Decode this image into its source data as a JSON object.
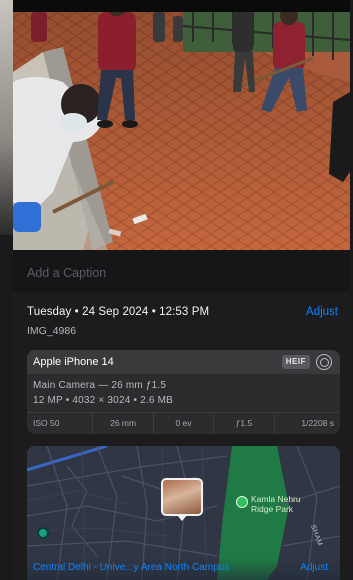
{
  "caption": {
    "placeholder": "Add a Caption"
  },
  "info": {
    "date_time": "Tuesday • 24 Sep 2024 • 12:53 PM",
    "adjust_label": "Adjust",
    "filename": "IMG_4986"
  },
  "device": {
    "name": "Apple iPhone 14",
    "format_badge": "HEIF",
    "camera": "Main Camera — 26 mm ƒ1.5",
    "specs": "12 MP • 4032 × 3024 • 2.6 MB",
    "exif": [
      "ISO 50",
      "26 mm",
      "0 ev",
      "ƒ1.5",
      "1/2208 s"
    ]
  },
  "map": {
    "park_label_line1": "Kamla Nehru",
    "park_label_line2": "Ridge Park",
    "road_label": "SHAM",
    "location_name": "Central Delhi - Unive...y Area North Campus",
    "adjust_label": "Adjust"
  },
  "colors": {
    "accent": "#0a84ff",
    "panel": "#1c1c1e",
    "card": "#2c2c2e",
    "park": "#1f7a45"
  },
  "icons": [
    "lens-icon",
    "location-pin-icon",
    "park-pin-icon"
  ]
}
